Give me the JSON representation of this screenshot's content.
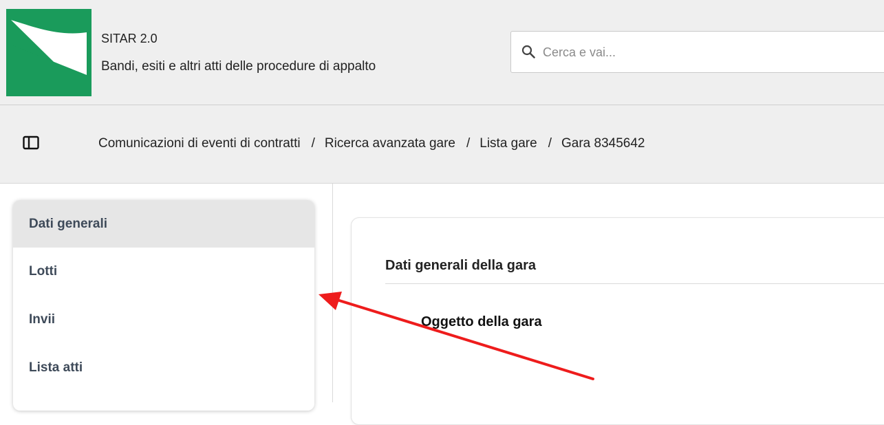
{
  "header": {
    "app_title": "SITAR 2.0",
    "app_subtitle": "Bandi, esiti e altri atti delle procedure di appalto",
    "logo_icon": "region-flag-logo",
    "logo_color": "#1a9b5b"
  },
  "search": {
    "placeholder": "Cerca e vai...",
    "value": "",
    "icon": "search-icon"
  },
  "breadcrumb": {
    "toggle_icon": "sidebar-toggle-icon",
    "separator": "/",
    "items": [
      "Comunicazioni di eventi di contratti",
      "Ricerca avanzata gare",
      "Lista gare",
      "Gara 8345642"
    ]
  },
  "sidebar": {
    "active_index": 0,
    "items": [
      {
        "label": "Dati generali"
      },
      {
        "label": "Lotti"
      },
      {
        "label": "Invii"
      },
      {
        "label": "Lista atti"
      }
    ]
  },
  "main": {
    "section_title": "Dati generali della gara",
    "field_label": "Oggetto della gara"
  },
  "annotation": {
    "arrow_color": "#ee1c1c"
  }
}
